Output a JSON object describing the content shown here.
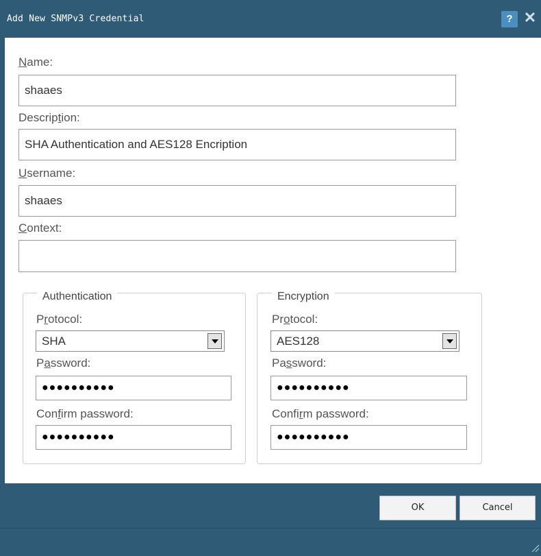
{
  "title": "Add New SNMPv3 Credential",
  "titlebar_buttons": {
    "help": "?",
    "close": "✕"
  },
  "fields": {
    "name": {
      "label_key": "N",
      "label_rest": "ame:",
      "value": "shaaes"
    },
    "description": {
      "label_pre": "Descrip",
      "label_key": "t",
      "label_post": "ion:",
      "value": "SHA Authentication and AES128 Encription"
    },
    "username": {
      "label_key": "U",
      "label_rest": "sername:",
      "value": "shaaes"
    },
    "context": {
      "label_key": "C",
      "label_rest": "ontext:",
      "value": ""
    }
  },
  "authentication": {
    "legend": "Authentication",
    "protocol_label_pre": "P",
    "protocol_label_key": "r",
    "protocol_label_post": "otocol:",
    "protocol_value": "SHA",
    "password_label_pre": "P",
    "password_label_key": "a",
    "password_label_post": "ssword:",
    "password_value": "●●●●●●●●●●",
    "confirm_label_pre": "Con",
    "confirm_label_key": "f",
    "confirm_label_post": "irm password:",
    "confirm_value": "●●●●●●●●●●"
  },
  "encryption": {
    "legend": "Encryption",
    "protocol_label_pre": "Pr",
    "protocol_label_key": "o",
    "protocol_label_post": "tocol:",
    "protocol_value": "AES128",
    "password_label_pre": "Pa",
    "password_label_key": "s",
    "password_label_post": "sword:",
    "password_value": "●●●●●●●●●●",
    "confirm_label_pre": "Confi",
    "confirm_label_key": "r",
    "confirm_label_post": "m password:",
    "confirm_value": "●●●●●●●●●●"
  },
  "buttons": {
    "ok": "OK",
    "cancel": "Cancel"
  },
  "colors": {
    "titlebar": "#2f5b77",
    "help_button": "#4b8fc0",
    "footer": "#2f5b77"
  },
  "icons": {
    "help": "help-icon",
    "close": "close-icon",
    "dropdown": "chevron-down-icon",
    "resize": "resize-grip-icon"
  }
}
